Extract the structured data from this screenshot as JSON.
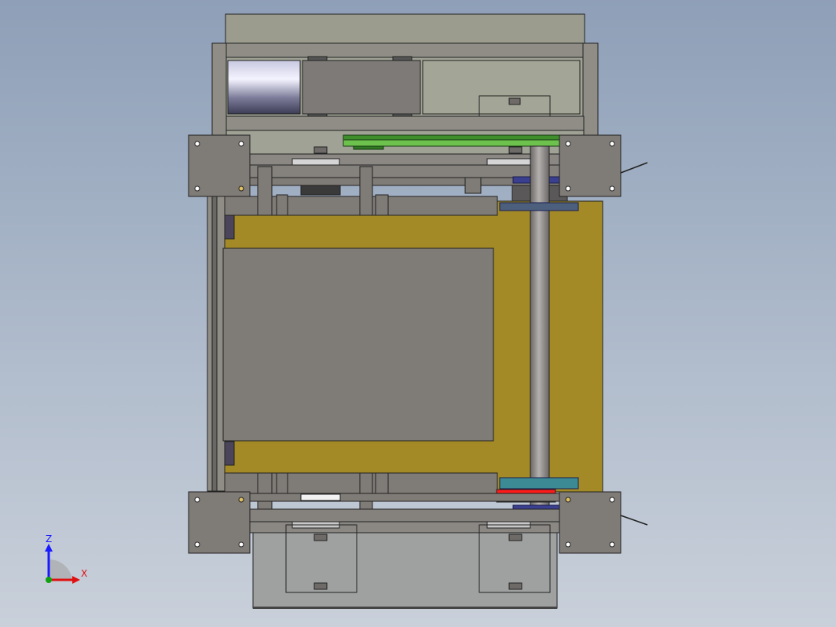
{
  "view": {
    "triad": {
      "z_label": "Z",
      "x_label": "X",
      "z_color": "#1a1aff",
      "x_color": "#e01010",
      "y_color": "#10a010"
    }
  },
  "colors": {
    "background_top": "#8e9fb7",
    "background_bottom": "#c9d0da",
    "frame_gray": "#7f7b76",
    "dark_gray": "#6f6c69",
    "light_panel": "#a9ab9b",
    "yellow_plate": "#a38a27",
    "belt_green": "#4a9a35",
    "chain_blue": "#3a3f8f",
    "red_block": "#ff1a1a",
    "shaft": "#8e8a88"
  }
}
